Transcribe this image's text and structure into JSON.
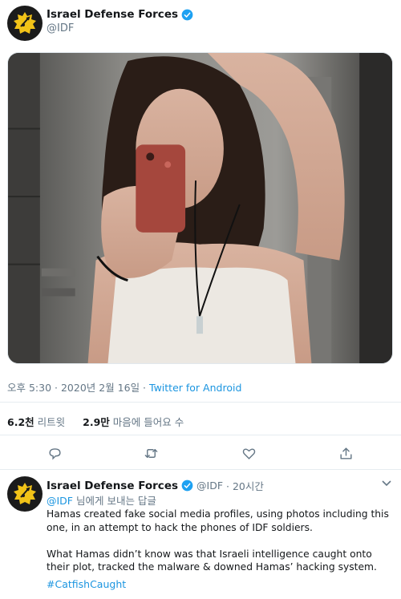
{
  "tweet": {
    "author": {
      "display_name": "Israel Defense Forces",
      "handle": "@IDF",
      "verified_icon": "verified-badge-icon",
      "avatar_icon": "idf-emblem-icon"
    },
    "image": {
      "alt": "photo"
    },
    "meta": {
      "time_date": "오후 5:30 · 2020년 2월 16일 · ",
      "source": "Twitter for Android"
    },
    "stats": {
      "retweets_count": "6.2천",
      "retweets_label": "리트윗",
      "likes_count": "2.9만",
      "likes_label": "마음에 들어요 수"
    },
    "actions": {
      "reply_icon": "reply-icon",
      "retweet_icon": "retweet-icon",
      "like_icon": "heart-icon",
      "share_icon": "share-icon"
    }
  },
  "reply": {
    "author": {
      "display_name": "Israel Defense Forces",
      "handle": "@IDF",
      "time": "· 20시간"
    },
    "replying_to_handle": "@IDF",
    "replying_to_suffix": " 님에게 보내는 답글",
    "paragraph_1": "Hamas created fake social media profiles, using photos including this one, in an attempt to hack the phones of IDF soldiers.",
    "paragraph_2": "What Hamas didn’t know was that Israeli intelligence caught onto their plot, tracked the malware & downed Hamas’ hacking system.",
    "hashtag": "#CatfishCaught"
  },
  "colors": {
    "link_blue": "#1b95e0",
    "muted_gray": "#657786",
    "text_dark": "#14171a",
    "divider": "#e6ecf0"
  }
}
